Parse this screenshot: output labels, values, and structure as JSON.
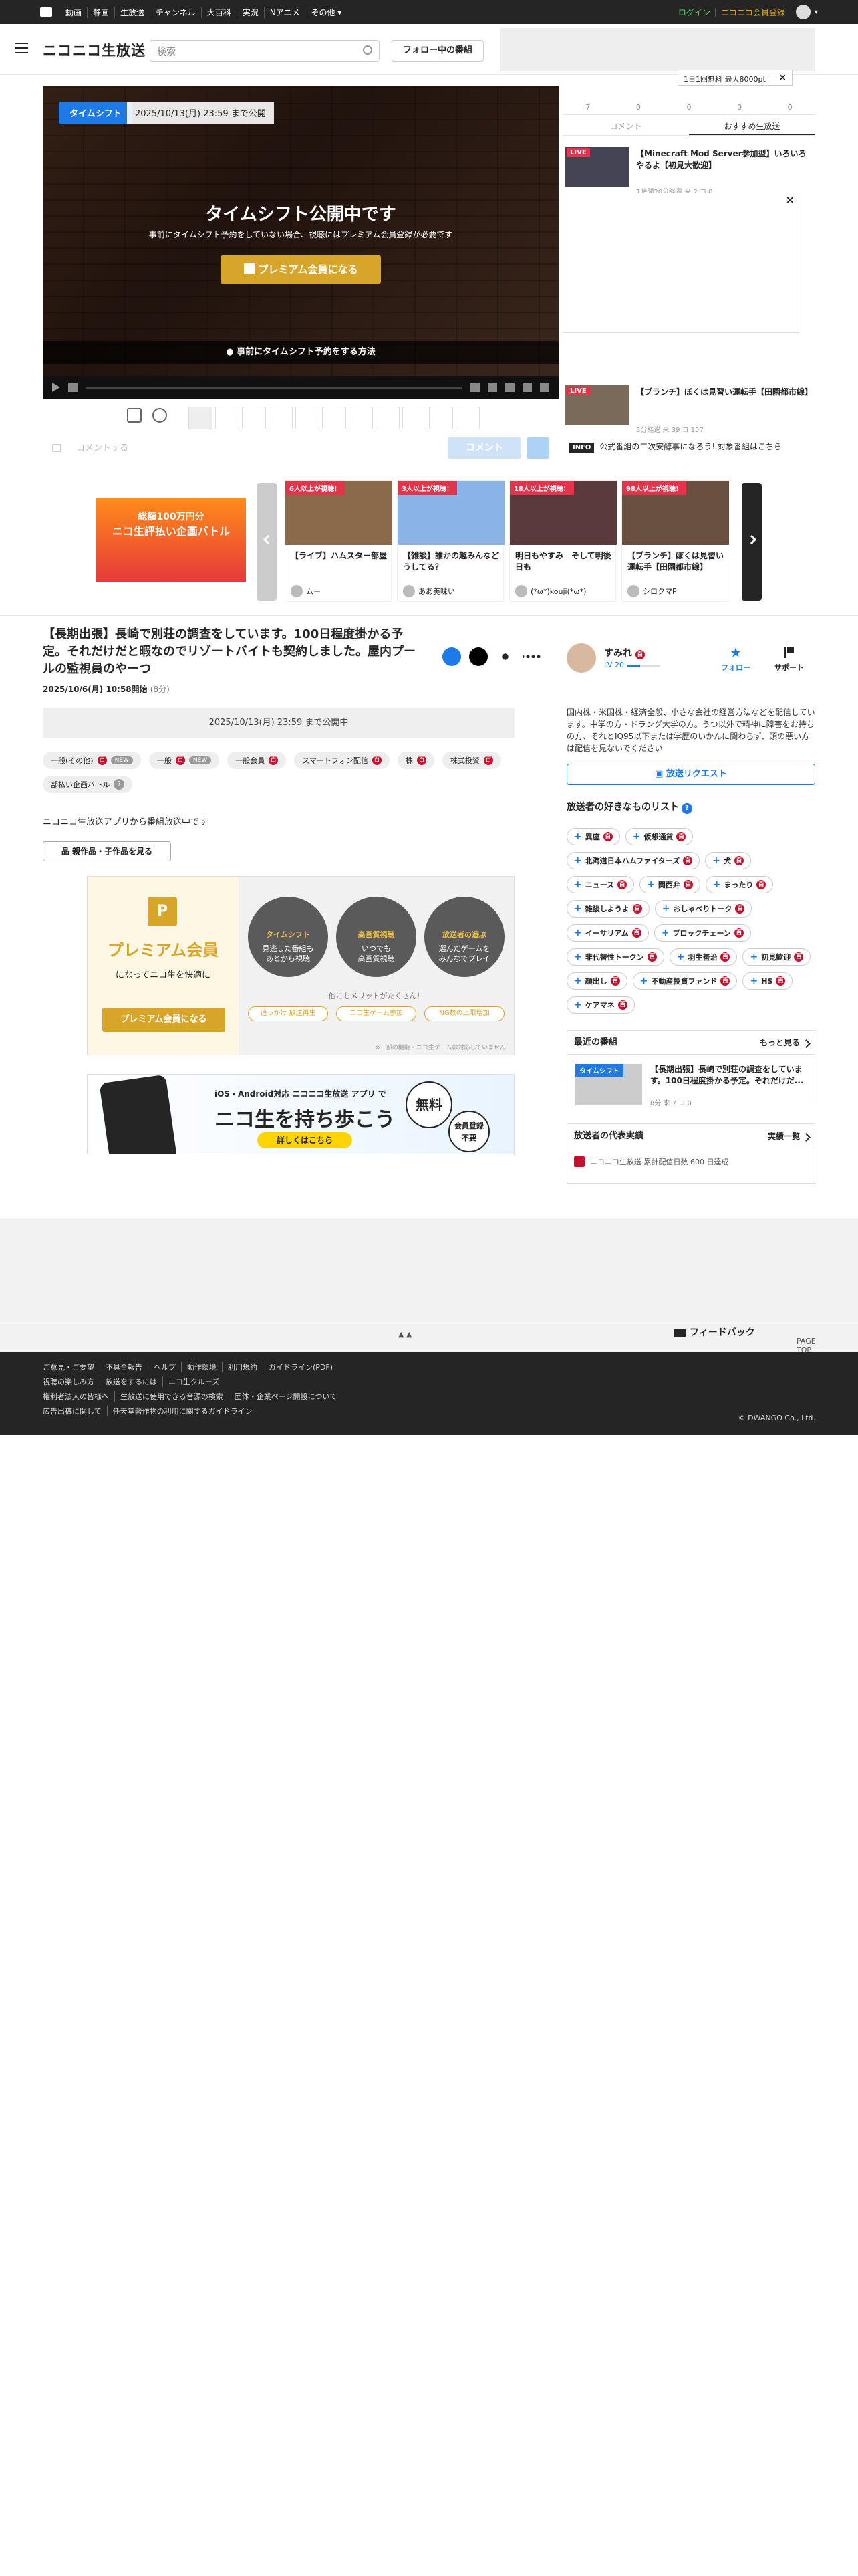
{
  "topbar": {
    "nav": [
      "動画",
      "静画",
      "生放送",
      "チャンネル",
      "大百科",
      "実況",
      "Nアニメ",
      "その他 ▾"
    ],
    "login": "ログイン",
    "register": "ニコニコ会員登録"
  },
  "header": {
    "logo": "ニコニコ生放送",
    "search_placeholder": "検索",
    "follow_label": "フォロー中の番組"
  },
  "player": {
    "badge": "タイムシフト",
    "publish_until": "2025/10/13(月) 23:59 まで公開",
    "overlay_title": "タイムシフト公開中です",
    "overlay_sub": "事前にタイムシフト予約をしていない場合、視聴にはプレミアム会員登録が必要です",
    "premium_button": "プレミアム会員になる",
    "reserve_link": "事前にタイムシフト予約をする方法",
    "comment_placeholder": "コメントする",
    "comment_button": "コメント"
  },
  "side": {
    "stat_values": [
      "7",
      "0",
      "0",
      "0",
      "0"
    ],
    "tab_comment": "コメント",
    "tab_recommend": "おすすめ生放送",
    "limit_badge": "1日1回無料 最大8000pt",
    "items": [
      {
        "tag": "LIVE",
        "title": "【Minecraft Mod Server参加型】いろいろやるよ【初見大歓迎】",
        "meta": "1時間20分経過 来 2 コ 0"
      },
      {
        "tag": "LIVE",
        "title": "【ブランチ】ぼくは見習い運転手【田園都市線】",
        "meta": "3分経過 来 39 コ 157"
      }
    ],
    "info_tag": "INFO",
    "info_text": "公式番組の二次安醇事になろう! 対象番組はこちら"
  },
  "carousel": {
    "ad_lines": [
      "総額100万円分",
      "ニコ生評払い企画バトル"
    ],
    "cards": [
      {
        "badge": "6人以上が視聴！",
        "title": "【ライブ】ハムスター部屋",
        "user": "ムー"
      },
      {
        "badge": "3人以上が視聴！",
        "title": "【雑談】誰かの趣みんなどうしてる？",
        "user": "ああ美味い"
      },
      {
        "badge": "18人以上が視聴！",
        "title": "明日もやすみ　そして明後日も",
        "user": "(*ω*)kouji(*ω*)"
      },
      {
        "badge": "98人以上が視聴！",
        "title": "【ブランチ】ぼくは見習い運転手【田園都市線】",
        "user": "シロクマP"
      }
    ]
  },
  "program": {
    "title": "【長期出張】長崎で別荘の調査をしています。100日程度掛かる予定。それだけだと暇なのでリゾートバイトも契約しました。屋内プールの監視員のやーつ",
    "started": "2025/10/6(月) 10:58開始",
    "duration": "(8分)",
    "publish_box": "2025/10/13(月) 23:59 まで公開中",
    "tags": [
      {
        "label": "一般(その他)",
        "dic": true,
        "count": "NEW"
      },
      {
        "label": "一般",
        "dic": true,
        "count": "NEW"
      },
      {
        "label": "一般会員",
        "dic": true
      },
      {
        "label": "スマートフォン配信",
        "dic": true
      },
      {
        "label": "株",
        "dic": true
      },
      {
        "label": "株式投資",
        "dic": true
      },
      {
        "label": "部払い企画バトル",
        "q": true
      }
    ],
    "description": "ニコニコ生放送アプリから番組放送中です",
    "works_button": "親作品・子作品を見る"
  },
  "premium_panel": {
    "heading": "プレミアム会員",
    "sub": "になってニコ生を快適に",
    "button": "プレミアム会員になる",
    "features": [
      {
        "title": "タイムシフト",
        "text": "見逃した番組も\nあとから視聴"
      },
      {
        "title": "高画質視聴",
        "text": "いつでも\n高画質視聴"
      },
      {
        "title": "放送者の遊ぶ",
        "text": "選んだゲームを\nみんなでプレイ"
      }
    ],
    "more": "他にもメリットがたくさん！",
    "chips": [
      "追っかけ 放送再生",
      "ニコ生ゲーム参加",
      "NG数の上限増加"
    ],
    "note": "※一部の機能・ニコ生ゲームは対応していません"
  },
  "app_banner": {
    "line1": "iOS・Android対応 ニコニコ生放送 アプリ で",
    "line2": "ニコ生を持ち歩こう",
    "button": "詳しくはこちら",
    "circle1": "無料",
    "circle2": "会員登録 不要"
  },
  "broadcaster": {
    "name": "すみれ",
    "level": "LV 20",
    "follow": "フォロー",
    "support": "サポート",
    "description": "国内株・米国株・経済全般、小さな会社の経営方法などを配信しています。中学の方・ドラング大学の方。うつ以外で精神に障害をお持ちの方、それとIQ95以下または学歴のいかんに関わらず、頭の悪い方は配信を見ないでください",
    "request_button": "放送リクエスト",
    "fav_heading": "放送者の好きなものリスト",
    "favorites": [
      "異座",
      "仮想通貨",
      "北海道日本ハムファイターズ",
      "犬",
      "ニュース",
      "関西弁",
      "まったり",
      "雑談しようよ",
      "おしゃべりトーク",
      "イーサリアム",
      "ブロックチェーン",
      "非代替性トークン",
      "羽生善治",
      "初見歓迎",
      "顔出し",
      "不動産投資ファンド",
      "HS",
      "ケアマネ"
    ],
    "recent_heading": "最近の番組",
    "recent_more": "もっと見る",
    "recent_tag": "タイムシフト",
    "recent_title": "【長期出張】長崎で別荘の調査をしています。100日程度掛かる予定。それだけだ...",
    "recent_meta": "8分 来 7 コ 0",
    "rep_heading": "放送者の代表実績",
    "rep_more": "実績一覧",
    "rep_text": "ニコニコ生放送 累計配信日数 600 日達成"
  },
  "footer": {
    "pagetop": "PAGE TOP",
    "feedback": "フィードバック",
    "row1": [
      "ご意見・ご要望",
      "不具合報告",
      "ヘルプ",
      "動作環境",
      "利用規約",
      "ガイドライン(PDF)"
    ],
    "row2": [
      "視聴の楽しみ方",
      "放送をするには",
      "ニコ生クルーズ"
    ],
    "row3": [
      "権利者法人の皆様へ",
      "生放送に使用できる音源の検索",
      "団体・企業ページ開設について"
    ],
    "row4": [
      "広告出稿に関して",
      "任天堂著作物の利用に関するガイドライン"
    ],
    "copyright": "© DWANGO Co., Ltd."
  }
}
